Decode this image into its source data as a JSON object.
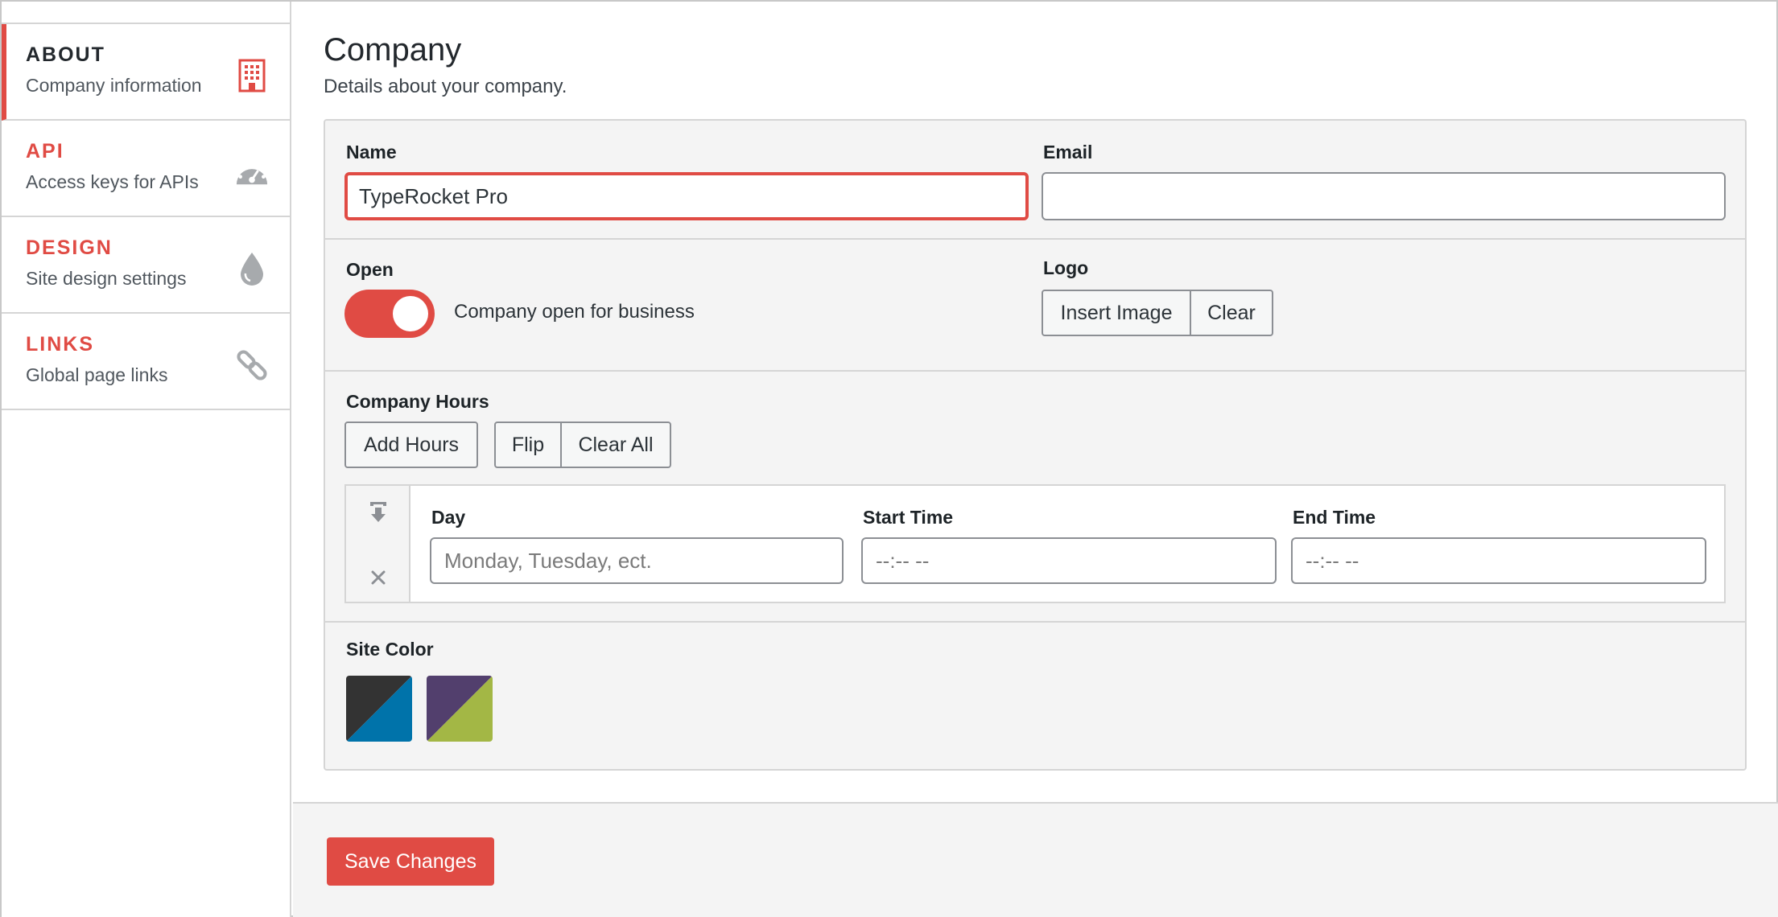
{
  "sidebar": {
    "items": [
      {
        "title": "ABOUT",
        "subtitle": "Company information",
        "icon": "building-icon",
        "active": true
      },
      {
        "title": "API",
        "subtitle": "Access keys for APIs",
        "icon": "dashboard-gauge-icon",
        "active": false
      },
      {
        "title": "DESIGN",
        "subtitle": "Site design settings",
        "icon": "droplet-icon",
        "active": false
      },
      {
        "title": "LINKS",
        "subtitle": "Global page links",
        "icon": "link-icon",
        "active": false
      }
    ]
  },
  "page": {
    "title": "Company",
    "subtitle": "Details about your company."
  },
  "form": {
    "name": {
      "label": "Name",
      "value": "TypeRocket Pro"
    },
    "email": {
      "label": "Email",
      "value": ""
    },
    "open": {
      "label": "Open",
      "toggle_text": "Company open for business",
      "checked": true
    },
    "logo": {
      "label": "Logo",
      "insert_label": "Insert Image",
      "clear_label": "Clear"
    },
    "hours": {
      "label": "Company Hours",
      "add_label": "Add Hours",
      "flip_label": "Flip",
      "clear_all_label": "Clear All",
      "row": {
        "day_label": "Day",
        "day_placeholder": "Monday, Tuesday, ect.",
        "start_label": "Start Time",
        "start_placeholder": "--:-- --",
        "end_label": "End Time",
        "end_placeholder": "--:-- --"
      }
    },
    "site_color": {
      "label": "Site Color",
      "options": [
        {
          "name": "dark-blue",
          "color_a": "#333333",
          "color_b": "#0073aa",
          "selected": true
        },
        {
          "name": "purple-green",
          "color_a": "#523f6d",
          "color_b": "#a3b745",
          "selected": false
        }
      ]
    }
  },
  "footer": {
    "save_label": "Save Changes"
  },
  "colors": {
    "accent": "#e04b44",
    "icon_gray": "#a7aaad"
  }
}
